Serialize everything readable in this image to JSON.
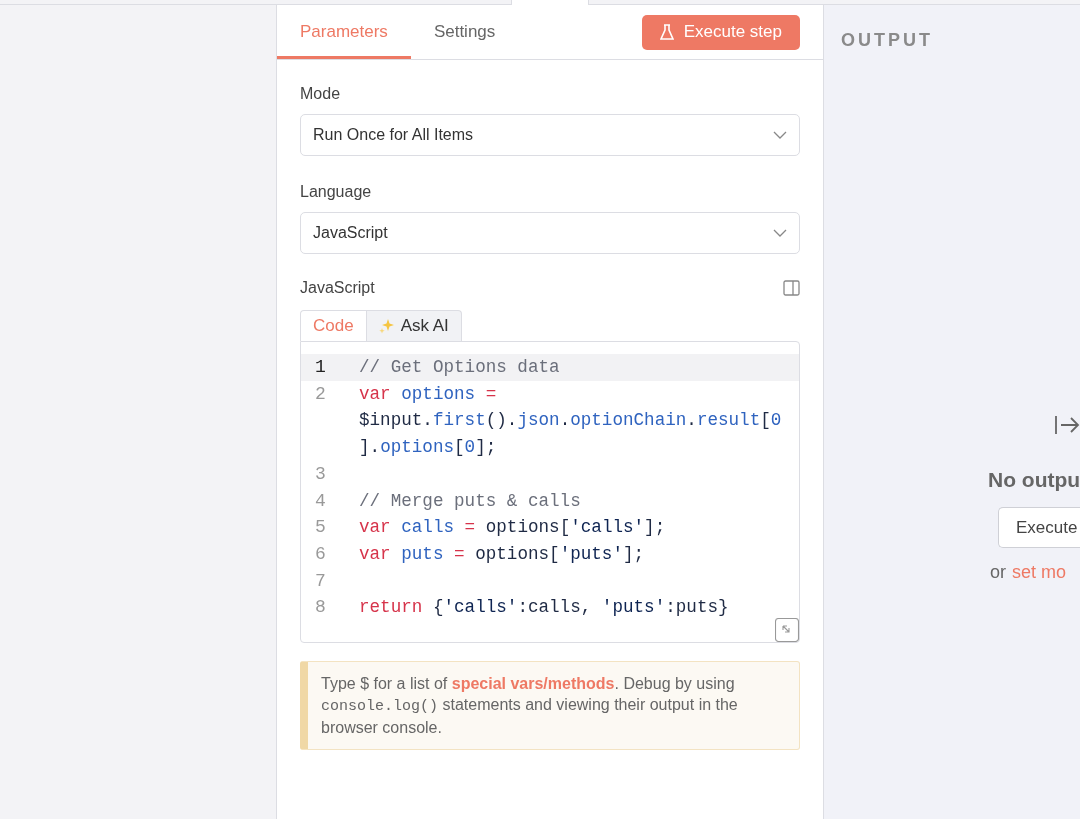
{
  "tabs": [
    {
      "label": "Parameters",
      "selected": true
    },
    {
      "label": "Settings",
      "selected": false
    }
  ],
  "execute_button": {
    "label": "Execute step"
  },
  "fields": [
    {
      "label": "Mode",
      "value": "Run Once for All Items"
    },
    {
      "label": "Language",
      "value": "JavaScript"
    }
  ],
  "code_section": {
    "label": "JavaScript",
    "tabs": [
      {
        "label": "Code",
        "selected": true,
        "kind": "plain"
      },
      {
        "label": "Ask AI",
        "selected": false,
        "kind": "ai"
      }
    ],
    "lines": [
      {
        "number": "1",
        "active": true,
        "tokens": [
          {
            "kind": "comment",
            "text": "// Get Options data"
          }
        ]
      },
      {
        "number": "2",
        "active": false,
        "tokens": [
          {
            "kind": "keyword",
            "text": "var"
          },
          {
            "kind": "name",
            "text": "options",
            "gap": true
          },
          {
            "kind": "keyword",
            "text": "=",
            "gap": true
          },
          {
            "kind": "plain",
            "text": "$input.",
            "gap": true
          },
          {
            "kind": "name",
            "text": "first"
          },
          {
            "kind": "plain",
            "text": "()."
          },
          {
            "kind": "name",
            "text": "json"
          },
          {
            "kind": "plain",
            "text": "."
          },
          {
            "kind": "name",
            "text": "optionChain"
          },
          {
            "kind": "plain",
            "text": "."
          },
          {
            "kind": "name",
            "text": "result"
          },
          {
            "kind": "plain",
            "text": "["
          },
          {
            "kind": "name",
            "text": "0"
          },
          {
            "kind": "plain",
            "text": "]."
          },
          {
            "kind": "name",
            "text": "options"
          },
          {
            "kind": "plain",
            "text": "["
          },
          {
            "kind": "name",
            "text": "0"
          },
          {
            "kind": "plain",
            "text": "];"
          }
        ]
      },
      {
        "number": "3",
        "active": false
      },
      {
        "number": "4",
        "active": false,
        "tokens": [
          {
            "kind": "comment",
            "text": "// Merge puts & calls"
          }
        ]
      },
      {
        "number": "5",
        "active": false,
        "tokens": [
          {
            "kind": "keyword",
            "text": "var"
          },
          {
            "kind": "name",
            "text": "calls",
            "gap": true
          },
          {
            "kind": "keyword",
            "text": "=",
            "gap": true
          },
          {
            "kind": "plain",
            "text": "options[",
            "gap": true
          },
          {
            "kind": "string",
            "text": "'calls'"
          },
          {
            "kind": "plain",
            "text": "];"
          }
        ]
      },
      {
        "number": "6",
        "active": false,
        "tokens": [
          {
            "kind": "keyword",
            "text": "var"
          },
          {
            "kind": "name",
            "text": "puts",
            "gap": true
          },
          {
            "kind": "keyword",
            "text": "=",
            "gap": true
          },
          {
            "kind": "plain",
            "text": "options[",
            "gap": true
          },
          {
            "kind": "string",
            "text": "'puts'"
          },
          {
            "kind": "plain",
            "text": "];"
          }
        ]
      },
      {
        "number": "7",
        "active": false
      },
      {
        "number": "8",
        "active": false,
        "tokens": [
          {
            "kind": "keyword",
            "text": "return"
          },
          {
            "kind": "plain",
            "text": "{",
            "gap": true
          },
          {
            "kind": "string",
            "text": "'calls'"
          },
          {
            "kind": "plain",
            "text": ":calls,"
          },
          {
            "kind": "string",
            "text": "'puts'",
            "gap": true
          },
          {
            "kind": "plain",
            "text": ":puts}"
          }
        ]
      }
    ]
  },
  "tip": {
    "parts": [
      {
        "kind": "text",
        "text": "Type $ for a list of "
      },
      {
        "kind": "link",
        "text": "special vars/methods"
      },
      {
        "kind": "text",
        "text": ". Debug by using "
      },
      {
        "kind": "code",
        "text": "console.log()"
      },
      {
        "kind": "text",
        "text": " statements and viewing their output in the browser console."
      }
    ]
  },
  "output": {
    "title": "OUTPUT",
    "message": "No outpu",
    "button": "Execute",
    "hint": "or",
    "hint_link": "set mo"
  }
}
